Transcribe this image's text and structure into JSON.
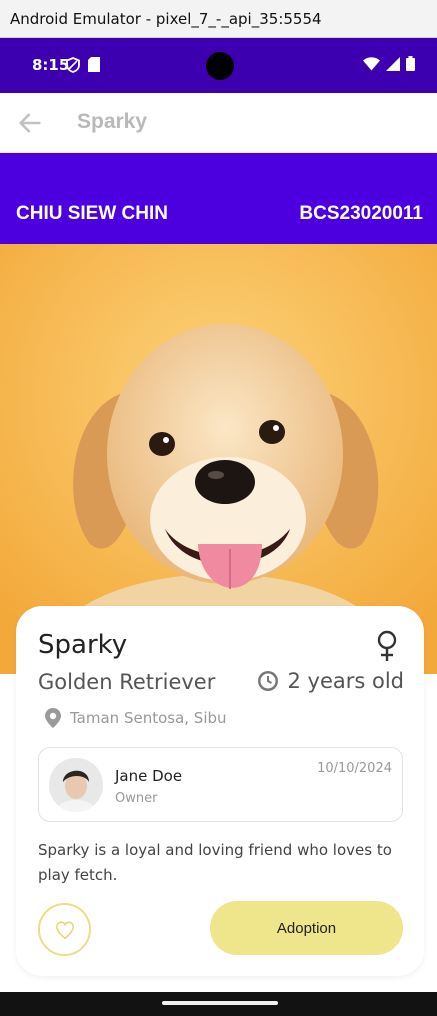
{
  "emulator": {
    "title": "Android Emulator - pixel_7_-_api_35:5554"
  },
  "status_bar": {
    "time": "8:15",
    "left_icons": [
      "shield-icon",
      "sd-card-icon"
    ],
    "right_icons": [
      "wifi-icon",
      "cell-signal-icon",
      "battery-icon"
    ]
  },
  "app_bar": {
    "back_icon": "back-arrow-icon",
    "title": "Sparky"
  },
  "banner": {
    "name": "CHIU SIEW CHIN",
    "student_id": "BCS23020011"
  },
  "pet": {
    "name": "Sparky",
    "gender_icon": "female-icon",
    "breed": "Golden Retriever",
    "age": "2 years old",
    "location": "Taman Sentosa, Sibu",
    "description": "Sparky is a loyal and loving friend who loves to play fetch."
  },
  "owner": {
    "name": "Jane Doe",
    "role": "Owner",
    "date": "10/10/2024"
  },
  "actions": {
    "favorite_icon": "heart-outline-icon",
    "adopt_label": "Adoption"
  },
  "colors": {
    "status_bar": "#3c00b0",
    "banner": "#4c00e0",
    "hero_bg": "#f7b84a",
    "accent": "#efe58a"
  }
}
